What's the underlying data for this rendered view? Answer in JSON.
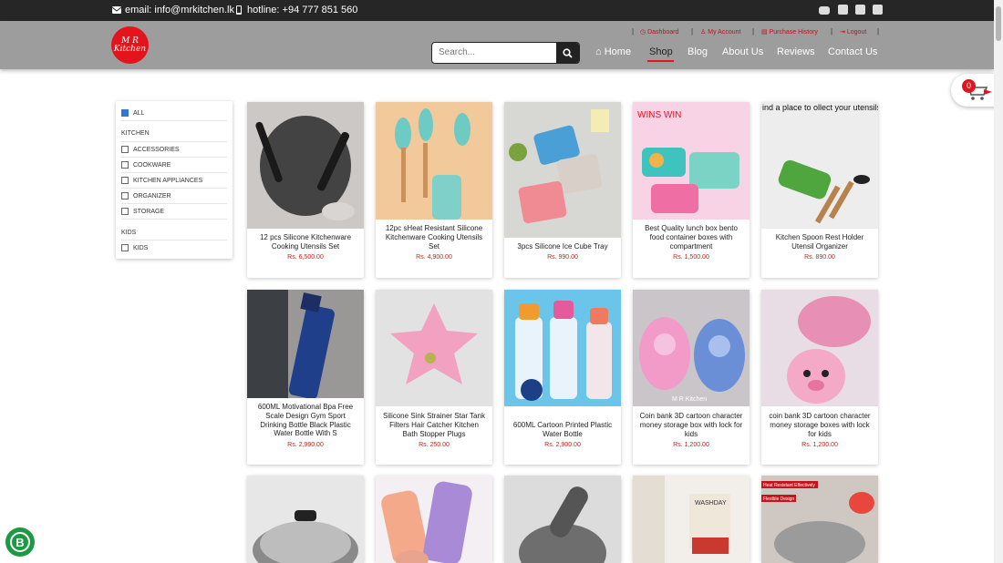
{
  "topbar": {
    "email": "email: info@mrkitchen.lk",
    "hotline": "hotline: +94 777 851 560",
    "social": [
      "youtube-icon",
      "facebook-icon",
      "twitter-icon",
      "linkedin-icon"
    ]
  },
  "brand": {
    "logo_line1": "M R",
    "logo_line2": "Kitchen"
  },
  "toplinks": {
    "dashboard": "Dashboard",
    "account": "My Account",
    "history": "Purchase History",
    "logout": "Logout"
  },
  "search": {
    "placeholder": "Search..."
  },
  "nav": {
    "home": "Home",
    "shop": "Shop",
    "blog": "Blog",
    "about": "About Us",
    "reviews": "Reviews",
    "contact": "Contact Us"
  },
  "cart": {
    "count": "0"
  },
  "filters": {
    "all": "ALL",
    "kitchen_heading": "KITCHEN",
    "kitchen": [
      "ACCESSORIES",
      "COOKWARE",
      "KITCHEN APPLIANCES",
      "ORGANIZER",
      "STORAGE"
    ],
    "kids_heading": "KIDS",
    "kids": [
      "KIDS"
    ]
  },
  "products": [
    {
      "title": "12 pcs Silicone Kitchenware Cooking Utensils Set",
      "price": "Rs. 6,500.00"
    },
    {
      "title": "12pc sHeat Resistant Silicone Kitchenware Cooking Utensils Set",
      "price": "Rs. 4,900.00"
    },
    {
      "title": "3pcs Silicone Ice Cube Tray",
      "price": "Rs. 990.00"
    },
    {
      "title": "Best Quality lunch box bento food container boxes with compartment",
      "price": "Rs. 1,500.00",
      "image_text": "WINS WIN"
    },
    {
      "title": "Kitchen Spoon Rest Holder Utensil Organizer",
      "price": "Rs. 890.00",
      "image_text": "ind a place to ollect your utensils"
    },
    {
      "title": "600ML Motivational Bpa Free Scale Design Gym Sport Drinking Bottle Black Plastic Water Bottle With S",
      "price": "Rs. 2,990.00"
    },
    {
      "title": "Silicone Sink Strainer Star Tank Filters Hair Catcher Kitchen Bath Stopper Plugs",
      "price": "Rs. 250.00"
    },
    {
      "title": "600ML Cartoon Printed Plastic Water Bottle",
      "price": "Rs. 2,900.00"
    },
    {
      "title": "Coin bank 3D cartoon character money storage box with lock for kids",
      "price": "Rs. 1,200.00",
      "image_text": "M R Kitchen"
    },
    {
      "title": "coin bank 3D cartoon character money storage boxes with lock for kids",
      "price": "Rs. 1,200.00"
    }
  ],
  "row3_labels": {
    "washday": "WASHDAY",
    "heat": "Heat Resistant Effectively",
    "flexible": "Flexible Design"
  },
  "fab": {
    "letter": "B"
  }
}
